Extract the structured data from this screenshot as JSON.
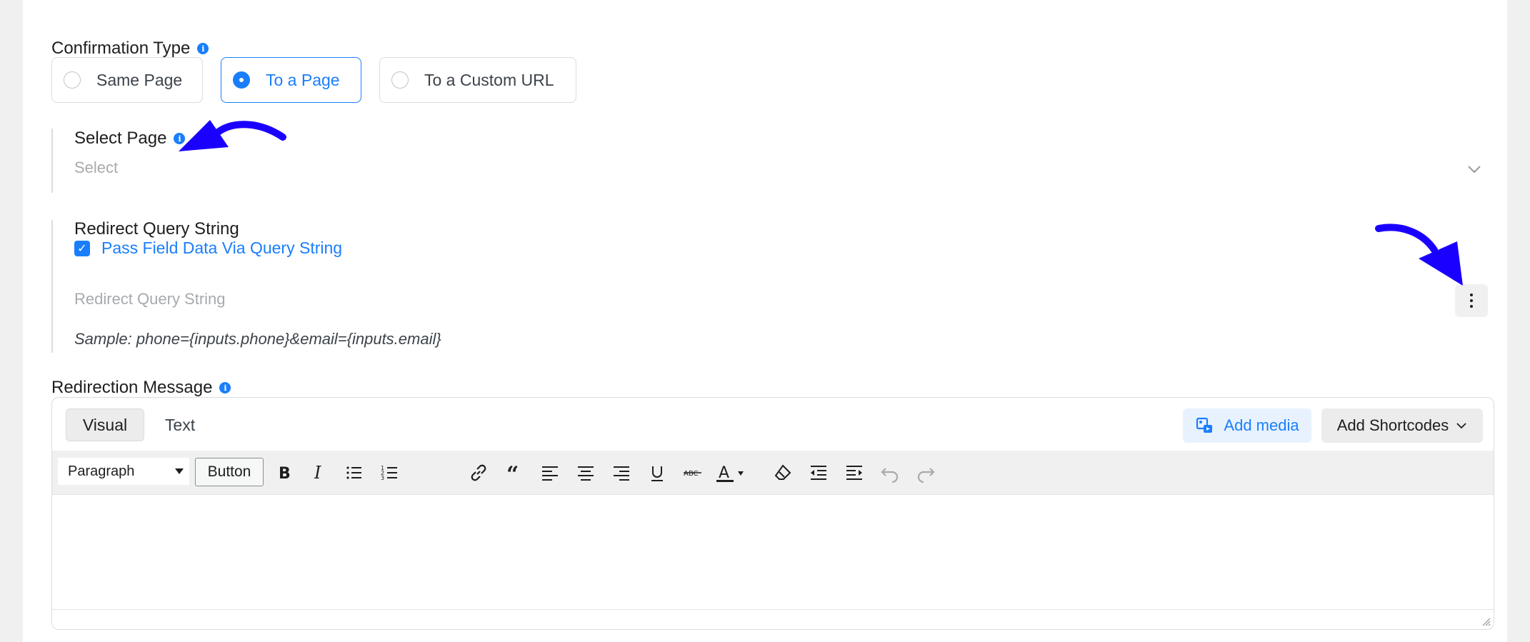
{
  "confirmation": {
    "label": "Confirmation Type",
    "options": [
      {
        "label": "Same Page",
        "selected": false
      },
      {
        "label": "To a Page",
        "selected": true
      },
      {
        "label": "To a Custom URL",
        "selected": false
      }
    ]
  },
  "select_page": {
    "label": "Select Page",
    "placeholder": "Select"
  },
  "redirect_query": {
    "label": "Redirect Query String",
    "checkbox_label": "Pass Field Data Via Query String",
    "checked": true,
    "input_placeholder": "Redirect Query String",
    "sample": "Sample: phone={inputs.phone}&email={inputs.email}"
  },
  "redirection_message": {
    "label": "Redirection Message",
    "tabs": [
      {
        "label": "Visual",
        "active": true
      },
      {
        "label": "Text",
        "active": false
      }
    ],
    "add_media": "Add media",
    "add_shortcodes": "Add Shortcodes",
    "format_select": "Paragraph",
    "button_label": "Button",
    "toolbar_icons": [
      "bold-icon",
      "italic-icon",
      "bullet-list-icon",
      "numbered-list-icon",
      "link-icon",
      "blockquote-icon",
      "align-left-icon",
      "align-center-icon",
      "align-right-icon",
      "underline-icon",
      "strikethrough-icon",
      "text-color-icon",
      "clear-formatting-icon",
      "outdent-icon",
      "indent-icon",
      "undo-icon",
      "redo-icon"
    ]
  },
  "colors": {
    "accent": "#1a7efb",
    "arrow": "#1a00ff"
  }
}
